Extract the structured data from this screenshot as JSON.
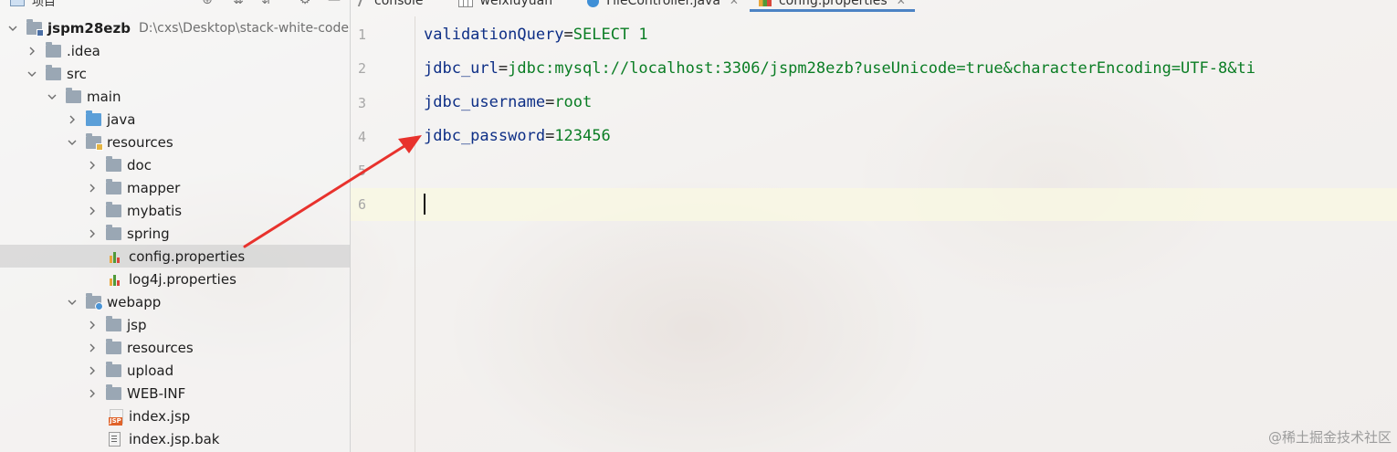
{
  "panel": {
    "title": "项目"
  },
  "tree": [
    {
      "label": "jspm28ezb",
      "note": "D:\\cxs\\Desktop\\stack-white-code"
    },
    {
      "label": ".idea"
    },
    {
      "label": "src"
    },
    {
      "label": "main"
    },
    {
      "label": "java"
    },
    {
      "label": "resources"
    },
    {
      "label": "doc"
    },
    {
      "label": "mapper"
    },
    {
      "label": "mybatis"
    },
    {
      "label": "spring"
    },
    {
      "label": "config.properties"
    },
    {
      "label": "log4j.properties"
    },
    {
      "label": "webapp"
    },
    {
      "label": "jsp"
    },
    {
      "label": "resources"
    },
    {
      "label": "upload"
    },
    {
      "label": "WEB-INF"
    },
    {
      "label": "index.jsp"
    },
    {
      "label": "index.jsp.bak"
    }
  ],
  "tabs": [
    {
      "label": "console"
    },
    {
      "label": "weixiuyuan"
    },
    {
      "label": "FileController.java"
    },
    {
      "label": "config.properties"
    }
  ],
  "editor": {
    "line_numbers": [
      "1",
      "2",
      "3",
      "4",
      "5",
      "6"
    ],
    "lines": [
      {
        "key": "validationQuery",
        "eq": "=",
        "value": "SELECT 1"
      },
      {
        "key": "jdbc_url",
        "eq": "=",
        "value": "jdbc:mysql://localhost:3306/jspm28ezb?useUnicode=true&characterEncoding=UTF-8&ti"
      },
      {
        "key": "jdbc_username",
        "eq": "=",
        "value": "root"
      },
      {
        "key": "jdbc_password",
        "eq": "=",
        "value": "123456"
      }
    ],
    "current_line": 6
  },
  "watermark": "@稀土掘金技术社区",
  "colors": {
    "accent": "#4c83c4",
    "key": "#0e2f86",
    "value": "#0a7d24",
    "arrow": "#e8322d"
  }
}
